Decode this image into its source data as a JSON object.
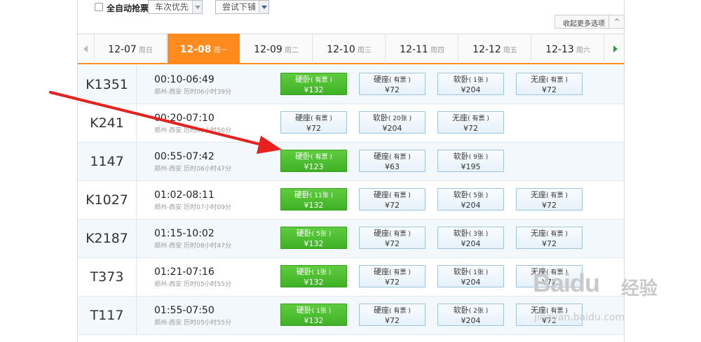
{
  "filter": {
    "auto_grab_label": "全自动抢票",
    "train_priority": "车次优先",
    "try_lower_berth": "尝试下铺",
    "collapse_label": "收起更多选项",
    "collapse_chevron": "^"
  },
  "tabs": [
    {
      "date": "12-07",
      "weekday": "周日"
    },
    {
      "date": "12-08",
      "weekday": "周一",
      "active": true
    },
    {
      "date": "12-09",
      "weekday": "周二"
    },
    {
      "date": "12-10",
      "weekday": "周三"
    },
    {
      "date": "12-11",
      "weekday": "周四"
    },
    {
      "date": "12-12",
      "weekday": "周五"
    },
    {
      "date": "12-13",
      "weekday": "周六"
    }
  ],
  "trains": [
    {
      "train": "K1351",
      "time": "00:10-06:49",
      "route": "郑州-西安 历时06小时39分",
      "seats": [
        {
          "name": "硬卧",
          "status": "有票",
          "price": "¥132",
          "green": true
        },
        {
          "name": "硬座",
          "status": "有票",
          "price": "¥72"
        },
        {
          "name": "软卧",
          "status": "1张",
          "price": "¥204"
        },
        {
          "name": "无座",
          "status": "有票",
          "price": "¥72"
        }
      ]
    },
    {
      "train": "K241",
      "time": "00:20-07:10",
      "route": "郑州-西安 历时06小时50分",
      "seats": [
        {
          "name": "硬座",
          "status": "有票",
          "price": "¥72"
        },
        {
          "name": "软卧",
          "status": "20张",
          "price": "¥204"
        },
        {
          "name": "无座",
          "status": "有票",
          "price": "¥72"
        }
      ]
    },
    {
      "train": "1147",
      "time": "00:55-07:42",
      "route": "郑州-西安 历时06小时47分",
      "seats": [
        {
          "name": "硬卧",
          "status": "有票",
          "price": "¥123",
          "green": true
        },
        {
          "name": "硬座",
          "status": "有票",
          "price": "¥63"
        },
        {
          "name": "软卧",
          "status": "9张",
          "price": "¥195"
        }
      ]
    },
    {
      "train": "K1027",
      "time": "01:02-08:11",
      "route": "郑州-西安 历时07小时09分",
      "seats": [
        {
          "name": "硬卧",
          "status": "11张",
          "price": "¥132",
          "green": true
        },
        {
          "name": "硬座",
          "status": "有票",
          "price": "¥72"
        },
        {
          "name": "软卧",
          "status": "5张",
          "price": "¥204"
        },
        {
          "name": "无座",
          "status": "有票",
          "price": "¥72"
        }
      ]
    },
    {
      "train": "K2187",
      "time": "01:15-10:02",
      "route": "郑州-西安 历时08小时47分",
      "seats": [
        {
          "name": "硬卧",
          "status": "5张",
          "price": "¥132",
          "green": true
        },
        {
          "name": "硬座",
          "status": "有票",
          "price": "¥72"
        },
        {
          "name": "软卧",
          "status": "3张",
          "price": "¥204"
        },
        {
          "name": "无座",
          "status": "有票",
          "price": "¥72"
        }
      ]
    },
    {
      "train": "T373",
      "time": "01:21-07:16",
      "route": "郑州-西安 历时05小时55分",
      "seats": [
        {
          "name": "硬卧",
          "status": "1张",
          "price": "¥132",
          "green": true
        },
        {
          "name": "硬座",
          "status": "有票",
          "price": "¥72"
        },
        {
          "name": "软卧",
          "status": "1张",
          "price": "¥204"
        },
        {
          "name": "无座",
          "status": "有票",
          "price": "¥72"
        }
      ]
    },
    {
      "train": "T117",
      "time": "01:55-07:50",
      "route": "郑州-西安 历时05小时55分",
      "seats": [
        {
          "name": "硬卧",
          "status": "1张",
          "price": "¥132",
          "green": true
        },
        {
          "name": "硬座",
          "status": "有票",
          "price": "¥72"
        },
        {
          "name": "软卧",
          "status": "2张",
          "price": "¥204"
        },
        {
          "name": "无座",
          "status": "有票",
          "price": "¥72"
        }
      ]
    }
  ],
  "watermark": {
    "logo": "Baidu",
    "cn": "经验",
    "url": "jingyan.baidu.com"
  },
  "colors": {
    "active_tab": "#ff8b1f",
    "green_seat": "#3fb126",
    "arrow": "#e8201d"
  }
}
